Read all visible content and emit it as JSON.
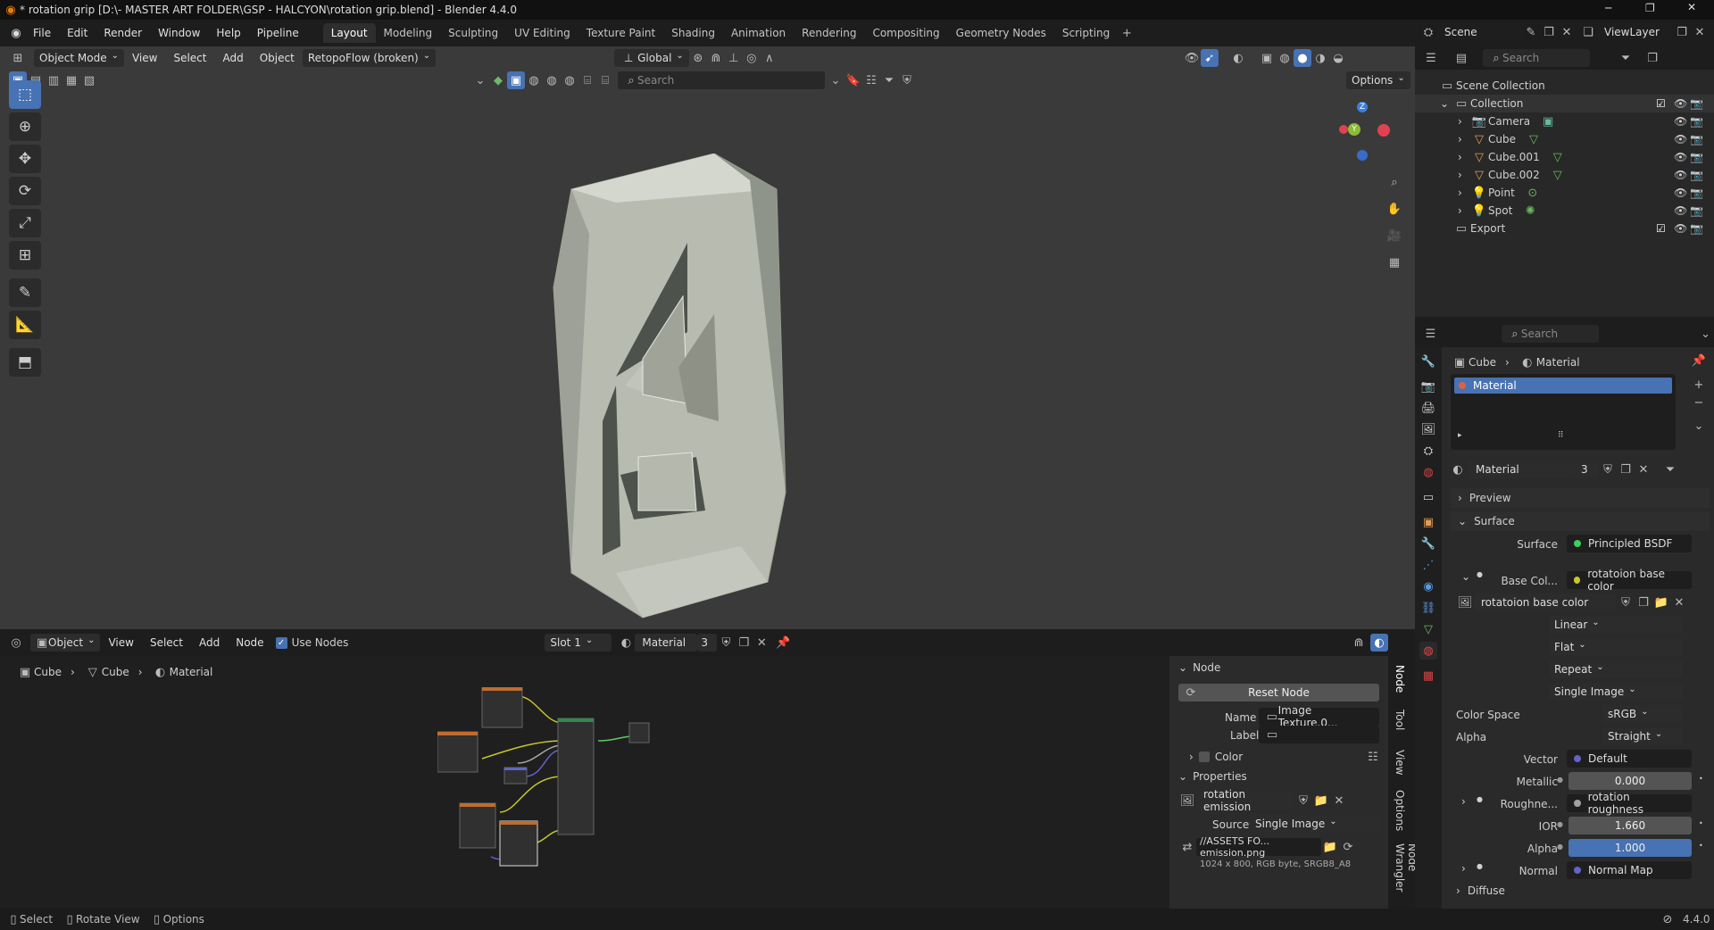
{
  "titlebar": {
    "title": "* rotation grip [D:\\- MASTER ART FOLDER\\GSP - HALCYON\\rotation grip.blend] - Blender 4.4.0"
  },
  "menu": [
    "File",
    "Edit",
    "Render",
    "Window",
    "Help",
    "Pipeline"
  ],
  "workspaces": [
    "Layout",
    "Modeling",
    "Sculpting",
    "UV Editing",
    "Texture Paint",
    "Shading",
    "Animation",
    "Rendering",
    "Compositing",
    "Geometry Nodes",
    "Scripting"
  ],
  "scene": {
    "name": "Scene",
    "view_layer": "ViewLayer"
  },
  "viewport": {
    "mode": "Object Mode",
    "menus": [
      "View",
      "Select",
      "Add",
      "Object"
    ],
    "addon_menu": "RetopoFlow (broken)",
    "orientation": "Global",
    "search_placeholder": "Search",
    "options_label": "Options",
    "gizmo": {
      "z": "Z",
      "y": "Y"
    }
  },
  "node_editor": {
    "editor_type": "Object",
    "menus": [
      "View",
      "Select",
      "Add",
      "Node"
    ],
    "use_nodes_label": "Use Nodes",
    "slot": "Slot 1",
    "material": "Material",
    "users": "3",
    "breadcrumb": [
      "Cube",
      "Cube",
      "Material"
    ],
    "panel": {
      "node_header": "Node",
      "reset_node": "Reset Node",
      "name_label": "Name",
      "name_value": "Image Texture.0...",
      "label_label": "Label",
      "color_label": "Color",
      "properties_header": "Properties",
      "image_name": "rotation emission",
      "source_label": "Source",
      "source_value": "Single Image",
      "path": "//ASSETS FO... emission.png",
      "info": "1024 x 800, RGB byte, SRGB8_A8"
    },
    "side_tabs": [
      "Node",
      "Tool",
      "View",
      "Options",
      "Node Wrangler"
    ]
  },
  "outliner": {
    "search_placeholder": "Search",
    "root": "Scene Collection",
    "collection": "Collection",
    "items": [
      "Camera",
      "Cube",
      "Cube.001",
      "Cube.002",
      "Point",
      "Spot"
    ],
    "export": "Export"
  },
  "properties": {
    "search_placeholder": "Search",
    "breadcrumb": [
      "Cube",
      "Material"
    ],
    "slot_item": "Material",
    "material_name": "Material",
    "users": "3",
    "preview": "Preview",
    "surface_header": "Surface",
    "surface_label": "Surface",
    "surface_value": "Principled BSDF",
    "base_color_label": "Base Col...",
    "base_color_value": "rotatoion base color",
    "image_name": "rotatoion base color",
    "interpolation": "Linear",
    "projection": "Flat",
    "extension": "Repeat",
    "source": "Single Image",
    "color_space_label": "Color Space",
    "color_space": "sRGB",
    "alpha_label": "Alpha",
    "alpha_mode": "Straight",
    "vector_label": "Vector",
    "vector_value": "Default",
    "metallic_label": "Metallic",
    "metallic_value": "0.000",
    "roughness_label": "Roughne...",
    "roughness_value": "rotation roughness",
    "ior_label": "IOR",
    "ior_value": "1.660",
    "alpha2_label": "Alpha",
    "alpha2_value": "1.000",
    "normal_label": "Normal",
    "normal_value": "Normal Map",
    "diffuse": "Diffuse"
  },
  "status": {
    "select": "Select",
    "rotate": "Rotate View",
    "options": "Options",
    "version": "4.4.0"
  }
}
